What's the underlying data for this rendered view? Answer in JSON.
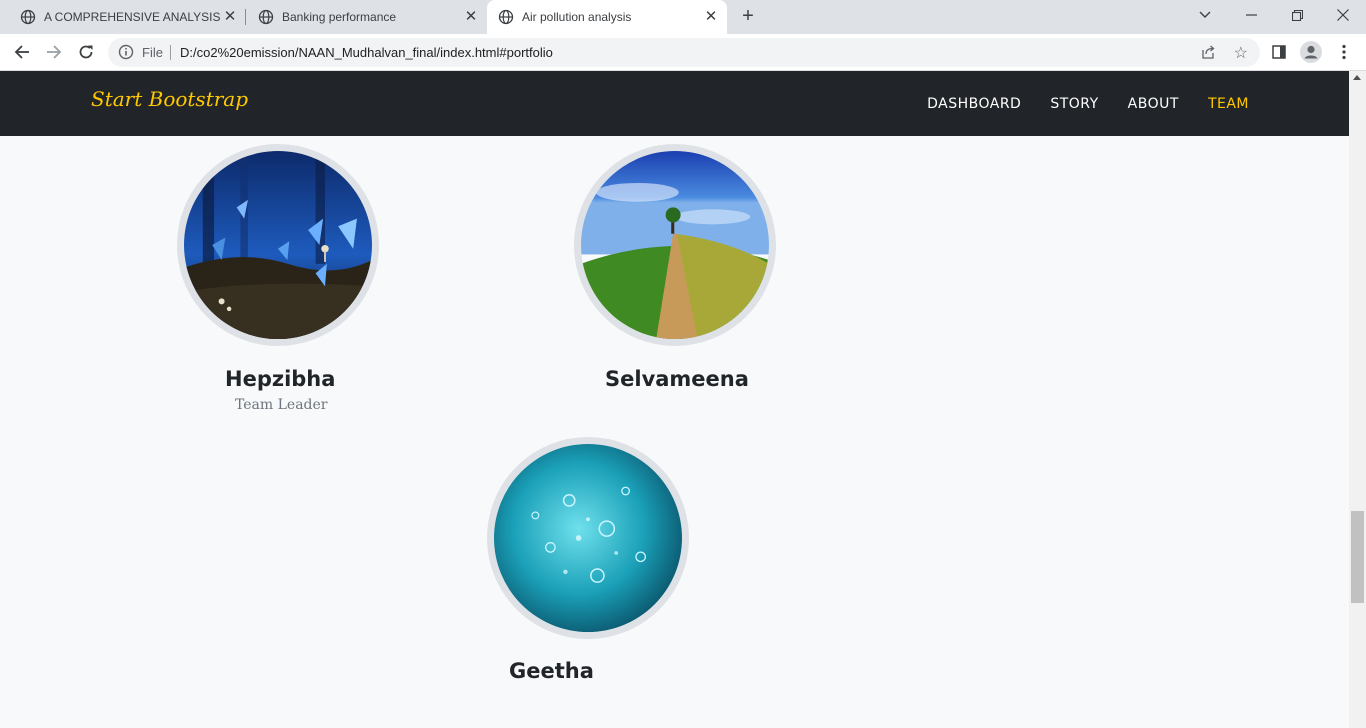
{
  "browser": {
    "tabs": [
      {
        "title": "A COMPREHENSIVE ANALYSIS OF",
        "icon": "globe-icon",
        "active": false
      },
      {
        "title": "Banking performance",
        "icon": "globe-icon",
        "active": false
      },
      {
        "title": "Air pollution analysis",
        "icon": "globe-icon",
        "active": true
      }
    ],
    "new_tab_label": "+",
    "address": {
      "scheme_label": "File",
      "url": "D:/co2%20emission/NAAN_Mudhalvan_final/index.html#portfolio"
    }
  },
  "site": {
    "brand": "Start Bootstrap",
    "brand_color": "#ffc800",
    "nav": [
      {
        "label": "DASHBOARD",
        "active": false
      },
      {
        "label": "STORY",
        "active": false
      },
      {
        "label": "ABOUT",
        "active": false
      },
      {
        "label": "TEAM",
        "active": true
      }
    ]
  },
  "team": {
    "members": [
      {
        "name": "Hepzibha",
        "role": "Team Leader",
        "image": "blue butterflies forest"
      },
      {
        "name": "Selvameena",
        "role": "",
        "image": "dirt road on green hill"
      },
      {
        "name": "Geetha",
        "role": "",
        "image": "underwater bubbles"
      }
    ]
  }
}
